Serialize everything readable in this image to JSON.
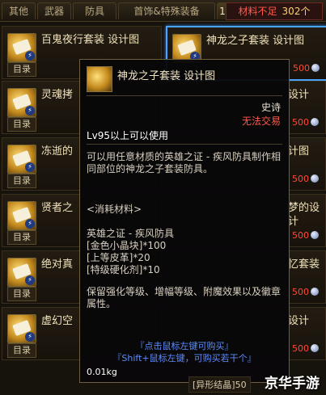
{
  "tabs": [
    "其他",
    "武器",
    "防具",
    "首饰&特殊装备",
    "1"
  ],
  "currency": {
    "label": "材料不足",
    "amount": "302个"
  },
  "mulu": "目录",
  "items": [
    {
      "name": "百鬼夜行套装  设计图",
      "price": ""
    },
    {
      "name": "神龙之子套装  设计图",
      "price": "500"
    },
    {
      "name": "灵魂拷",
      "price": ""
    },
    {
      "name": "设计",
      "price": "500"
    },
    {
      "name": "冻逝的",
      "price": ""
    },
    {
      "name": "计图",
      "price": "500"
    },
    {
      "name": "贤者之",
      "price": ""
    },
    {
      "name": "梦的设计",
      "price": "500"
    },
    {
      "name": "绝对真",
      "price": ""
    },
    {
      "name": "忆套装",
      "price": "500"
    },
    {
      "name": "虚幻空",
      "price": ""
    },
    {
      "name": "设计",
      "price": "500"
    }
  ],
  "tooltip": {
    "title": "神龙之子套装  设计图",
    "grade": "史诗",
    "trade": "无法交易",
    "level": "Lv95以上可以使用",
    "description": "可以用任意材质的英雄之证 - 疾风防具制作相同部位的神龙之子套装防具。",
    "materials_header": "<消耗材料>",
    "materials": [
      "英雄之证 - 疾风防具",
      "[金色小晶块]*100",
      "[上等皮革]*20",
      "[特级硬化剂]*10"
    ],
    "effect": "保留强化等级、增幅等级、附魔效果以及徽章属性。",
    "hint1": "『点击鼠标左键可购买』",
    "hint2": "『Shift+鼠标左键，可购买若干个』",
    "weight": "0.01kg"
  },
  "footer_label": "[异形结晶]50",
  "watermark": "京华手游"
}
